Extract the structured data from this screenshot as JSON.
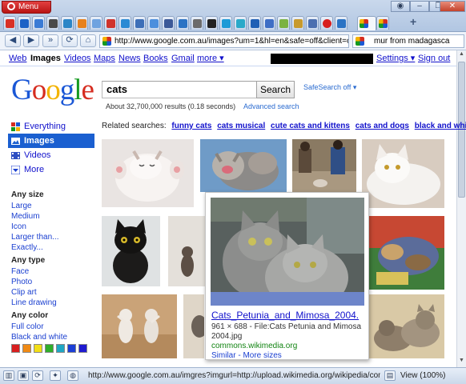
{
  "browser": {
    "menu_label": "Menu",
    "address": "http://www.google.com.au/images?um=1&hl=en&safe=off&client=opera",
    "search_field": "mur from madagasca",
    "status_url": "http://www.google.com.au/imgres?imgurl=http://upload.wikimedia.org/wikipedia/commo...",
    "zoom": "View (100%)",
    "tab_close": "×",
    "new_tab": "+"
  },
  "gbar": {
    "links": [
      "Web",
      "Images",
      "Videos",
      "Maps",
      "News",
      "Books",
      "Gmail",
      "more ▾"
    ],
    "settings": "Settings ▾",
    "sign_out": "Sign out"
  },
  "search": {
    "query": "cats",
    "button": "Search",
    "safesearch": "SafeSearch off ▾",
    "stats": "About 32,700,000 results (0.18 seconds)",
    "advanced": "Advanced search"
  },
  "leftnav": {
    "items": [
      {
        "label": "Everything",
        "icon": "everything-icon"
      },
      {
        "label": "Images",
        "icon": "images-icon"
      },
      {
        "label": "Videos",
        "icon": "videos-icon"
      },
      {
        "label": "More",
        "icon": "more-chevron-icon"
      }
    ]
  },
  "filters": {
    "size_heading": "Any size",
    "sizes": [
      "Large",
      "Medium",
      "Icon",
      "Larger than...",
      "Exactly..."
    ],
    "type_heading": "Any type",
    "types": [
      "Face",
      "Photo",
      "Clip art",
      "Line drawing"
    ],
    "color_heading": "Any color",
    "colors": [
      "Full color",
      "Black and white"
    ],
    "swatches": [
      "#d81f1f",
      "#f08a14",
      "#f2de16",
      "#2fae2a",
      "#1fa7c4",
      "#1c3fd6",
      "#1f1ad0"
    ]
  },
  "related": {
    "label": "Related searches:",
    "items": [
      "funny cats",
      "cats musical",
      "cute cats and kittens",
      "cats and dogs",
      "black and whit"
    ]
  },
  "popup": {
    "title": "Cats_Petunia_and_Mimosa_2004.",
    "meta": "961 × 688 - File:Cats Petunia and Mimosa 2004.jpg",
    "source": "commons.wikimedia.org",
    "similar": "Similar",
    "more_sizes": "More sizes",
    "links_sep": " - "
  }
}
